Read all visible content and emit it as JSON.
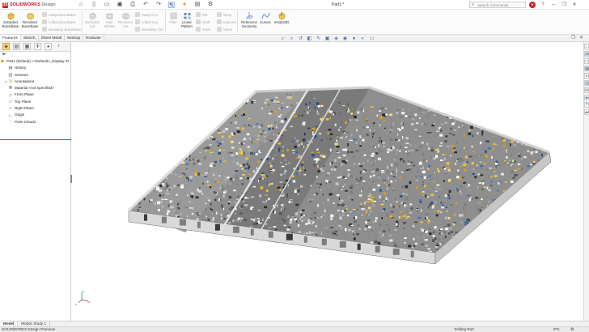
{
  "app": {
    "logo_brand": "SOLIDWORKS",
    "logo_product": "Design",
    "document_title": "Part1 *",
    "search_placeholder": "Search Commands"
  },
  "quick_access": [
    {
      "icon": "home-icon"
    },
    {
      "icon": "new-file-icon"
    },
    {
      "icon": "open-folder-icon"
    },
    {
      "icon": "save-icon"
    },
    {
      "icon": "print-icon"
    },
    {
      "icon": "undo-icon"
    },
    {
      "icon": "redo-icon"
    },
    {
      "icon": "select-arrow-icon"
    },
    {
      "icon": "rebuild-icon"
    },
    {
      "icon": "file-properties-icon"
    },
    {
      "icon": "options-gear-icon"
    }
  ],
  "ribbon": {
    "extruded_boss": "Extruded Boss/Base",
    "revolved_boss": "Revolved Boss/Base",
    "swept_boss": "Swept Boss/Base",
    "lofted_boss": "Lofted Boss/Base",
    "boundary_boss": "Boundary Boss/Base",
    "extruded_cut": "Extruded Cut",
    "hole_wizard": "Hole Wizard",
    "revolved_cut": "Revolved Cut",
    "swept_cut": "Swept Cut",
    "lofted_cut": "Lofted Cut",
    "boundary_cut": "Boundary Cut",
    "fillet": "Fillet",
    "linear_pattern": "Linear Pattern",
    "rib": "Rib",
    "draft": "Draft",
    "shell": "Shell",
    "wrap": "Wrap",
    "intersect": "Intersect",
    "mirror": "Mirror",
    "reference_geometry": "Reference Geometry",
    "curves": "Curves",
    "instant3d": "Instant3D"
  },
  "command_tabs": [
    "Features",
    "Sketch",
    "Sheet Metal",
    "Markup",
    "Evaluate"
  ],
  "feature_tree": {
    "root": "Part1 (Default) <<Default>_Display St",
    "items": [
      {
        "label": "History",
        "icon": "history-folder-icon",
        "expand": ""
      },
      {
        "label": "Sensors",
        "icon": "sensors-folder-icon",
        "expand": ""
      },
      {
        "label": "Annotations",
        "icon": "annotations-icon",
        "expand": "▸"
      },
      {
        "label": "Material <not specified>",
        "icon": "material-icon",
        "expand": ""
      },
      {
        "label": "Front Plane",
        "icon": "plane-icon",
        "expand": ""
      },
      {
        "label": "Top Plane",
        "icon": "plane-icon",
        "expand": ""
      },
      {
        "label": "Right Plane",
        "icon": "plane-icon",
        "expand": ""
      },
      {
        "label": "Origin",
        "icon": "origin-icon",
        "expand": ""
      },
      {
        "label": "Point Cloud1",
        "icon": "point-cloud-icon",
        "expand": ""
      }
    ]
  },
  "bottom_tabs": [
    "Model",
    "Motion Study 1"
  ],
  "status": {
    "left": "SOLIDWORKS Design Premium",
    "mode": "Editing Part",
    "units": "IPS"
  },
  "triad": {
    "x": "x",
    "y": "y",
    "z": "z"
  },
  "colors": {
    "brand_red": "#c8102e",
    "selection_blue": "#1f6fd6",
    "ribbon_bg": "#fbfbfb",
    "viewport_bg": "#ffffff"
  }
}
